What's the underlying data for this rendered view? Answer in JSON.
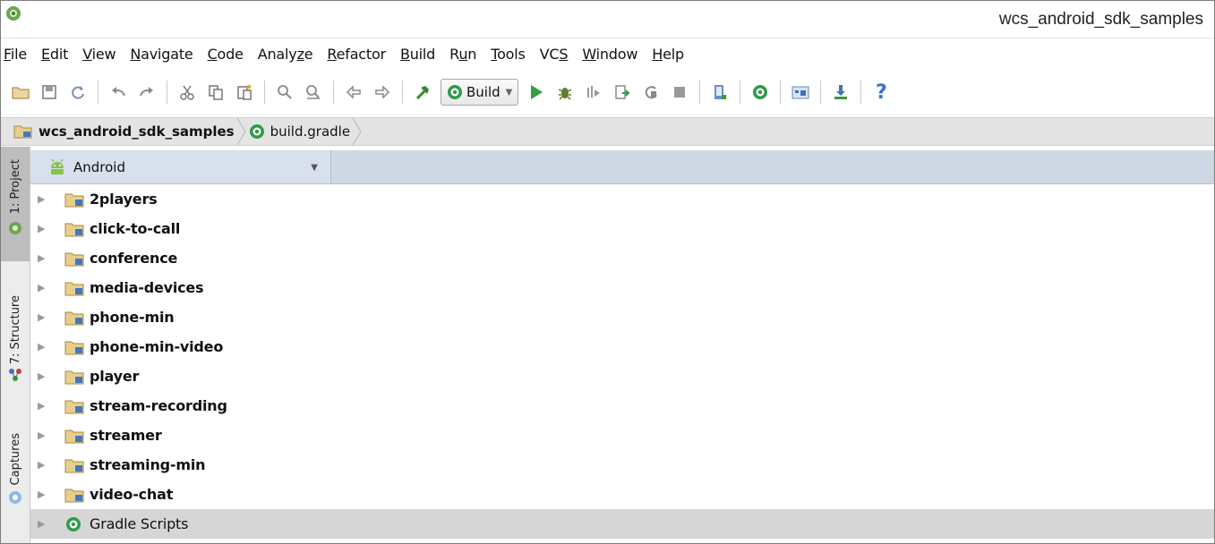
{
  "window": {
    "title": "wcs_android_sdk_samples"
  },
  "menu": [
    {
      "pre": "",
      "mn": "F",
      "post": "ile"
    },
    {
      "pre": "",
      "mn": "E",
      "post": "dit"
    },
    {
      "pre": "",
      "mn": "V",
      "post": "iew"
    },
    {
      "pre": "",
      "mn": "N",
      "post": "avigate"
    },
    {
      "pre": "",
      "mn": "C",
      "post": "ode"
    },
    {
      "pre": "Analy",
      "mn": "z",
      "post": "e"
    },
    {
      "pre": "",
      "mn": "R",
      "post": "efactor"
    },
    {
      "pre": "",
      "mn": "B",
      "post": "uild"
    },
    {
      "pre": "R",
      "mn": "u",
      "post": "n"
    },
    {
      "pre": "",
      "mn": "T",
      "post": "ools"
    },
    {
      "pre": "VC",
      "mn": "S",
      "post": ""
    },
    {
      "pre": "",
      "mn": "W",
      "post": "indow"
    },
    {
      "pre": "",
      "mn": "H",
      "post": "elp"
    }
  ],
  "toolbar": {
    "build_config": "Build",
    "help_glyph": "?"
  },
  "breadcrumb": {
    "project": "wcs_android_sdk_samples",
    "file": "build.gradle"
  },
  "side_tabs": {
    "project": "1: Project",
    "structure": "7: Structure",
    "captures": "Captures"
  },
  "panel": {
    "view_mode": "Android"
  },
  "tree": [
    {
      "label": "2players",
      "type": "module"
    },
    {
      "label": "click-to-call",
      "type": "module"
    },
    {
      "label": "conference",
      "type": "module"
    },
    {
      "label": "media-devices",
      "type": "module"
    },
    {
      "label": "phone-min",
      "type": "module"
    },
    {
      "label": "phone-min-video",
      "type": "module"
    },
    {
      "label": "player",
      "type": "module"
    },
    {
      "label": "stream-recording",
      "type": "module"
    },
    {
      "label": "streamer",
      "type": "module"
    },
    {
      "label": "streaming-min",
      "type": "module"
    },
    {
      "label": "video-chat",
      "type": "module"
    },
    {
      "label": "Gradle Scripts",
      "type": "gradle"
    }
  ],
  "colors": {
    "accent_green": "#3a9b3a",
    "panel_header": "#ced8e5",
    "selection": "#d6d6d6",
    "help_blue": "#3b6fd1"
  }
}
